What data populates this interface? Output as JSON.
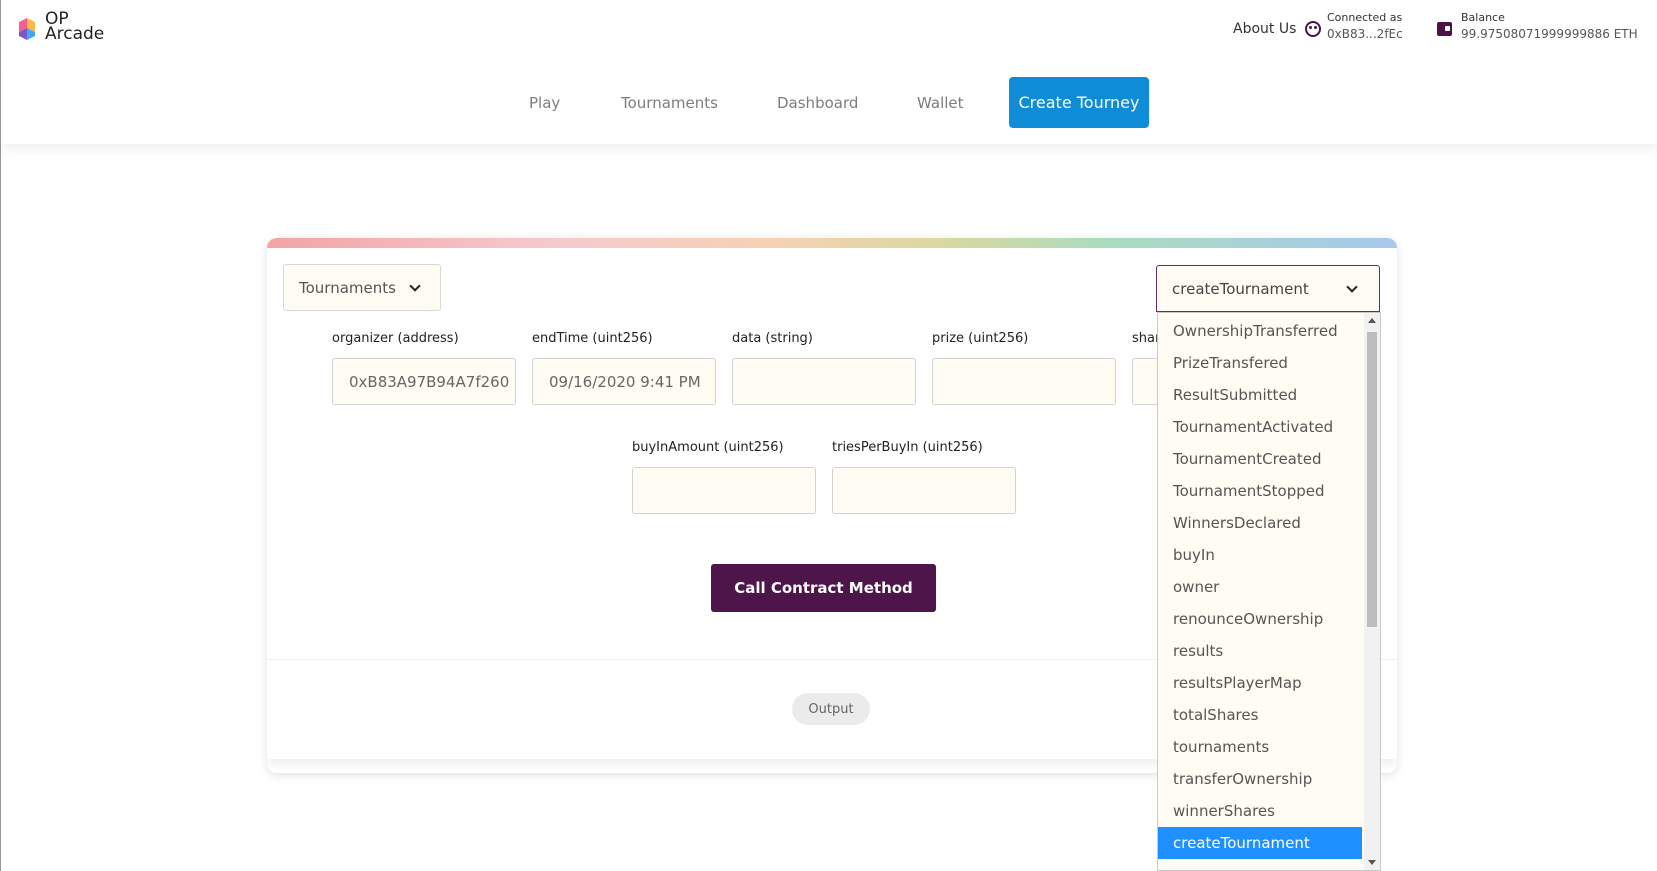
{
  "header": {
    "logo_line1": "OP",
    "logo_line2": "Arcade",
    "about_label": "About Us",
    "connected_label": "Connected as",
    "connected_address": "0xB83...2fEc",
    "balance_label": "Balance",
    "balance_value": "99.97508071999999886 ETH"
  },
  "nav": {
    "items": [
      "Play",
      "Tournaments",
      "Dashboard",
      "Wallet"
    ],
    "active": "Create Tourney",
    "active_color": "#0e8cd8"
  },
  "form": {
    "contract_select": "Tournaments",
    "method_select": "createTournament",
    "fields": [
      {
        "label": "organizer (address)",
        "value": "0xB83A97B94A7f260"
      },
      {
        "label": "endTime (uint256)",
        "value": "09/16/2020 9:41 PM"
      },
      {
        "label": "data (string)",
        "value": ""
      },
      {
        "label": "prize (uint256)",
        "value": ""
      },
      {
        "label": "shar",
        "value": ""
      },
      {
        "label": "buyInAmount (uint256)",
        "value": ""
      },
      {
        "label": "triesPerBuyIn (uint256)",
        "value": ""
      }
    ],
    "call_button": "Call Contract Method",
    "call_button_color": "#4d1549",
    "output_label": "Output"
  },
  "dropdown": {
    "options": [
      "OwnershipTransferred",
      "PrizeTransfered",
      "ResultSubmitted",
      "TournamentActivated",
      "TournamentCreated",
      "TournamentStopped",
      "WinnersDeclared",
      "buyIn",
      "owner",
      "renounceOwnership",
      "results",
      "resultsPlayerMap",
      "totalShares",
      "tournaments",
      "transferOwnership",
      "winnerShares",
      "createTournament"
    ],
    "selected": "createTournament",
    "selected_color": "#1e90ff"
  },
  "icons": {
    "logo": "op-arcade-logo-icon",
    "connected": "smiley-face-icon",
    "balance": "wallet-icon",
    "chevron": "chevron-down-icon"
  }
}
